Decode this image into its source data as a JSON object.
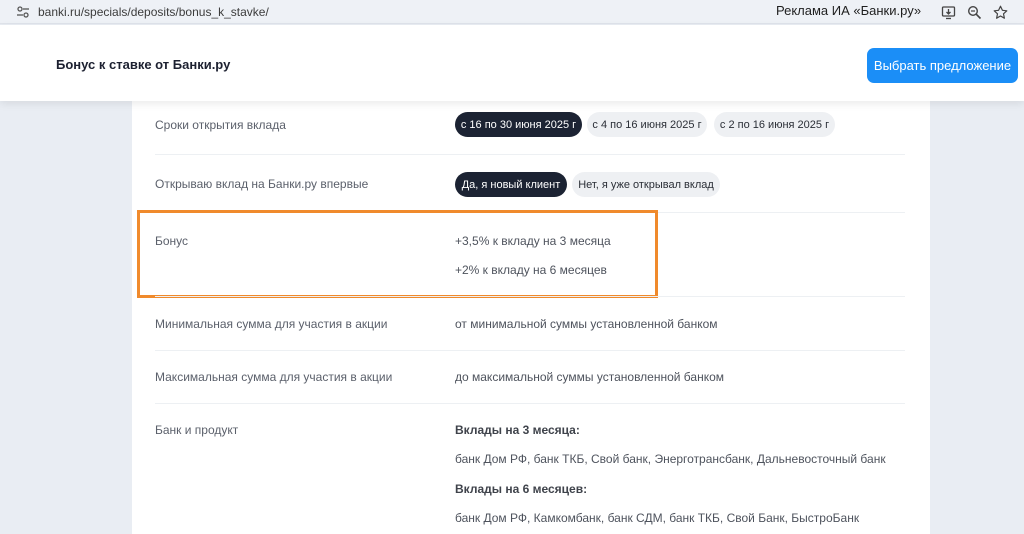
{
  "browser": {
    "url": "banki.ru/specials/deposits/bonus_k_stavke/",
    "ad_label": "Реклама ИА «Банки.ру»",
    "icons": [
      "site-settings-icon",
      "install-app-icon",
      "zoom-icon",
      "bookmark-star-icon"
    ]
  },
  "header": {
    "title": "Бонус к ставке от Банки.ру",
    "cta_label": "Выбрать предложение"
  },
  "rows": {
    "period": {
      "label": "Сроки открытия вклада",
      "options": [
        "с 16 по 30 июня 2025 г",
        "с 4 по 16 июня 2025 г",
        "с 2 по 16 июня 2025 г"
      ],
      "selected": "с 16 по 30 июня 2025 г"
    },
    "first_time": {
      "label": "Открываю вклад на Банки.ру впервые",
      "options": [
        "Да, я новый клиент",
        "Нет, я уже открывал вклад"
      ],
      "selected": "Да, я новый клиент"
    },
    "bonus": {
      "label": "Бонус",
      "values": [
        "+3,5% к вкладу на 3 месяца",
        "+2% к вкладу на 6 месяцев"
      ]
    },
    "min_sum": {
      "label": "Минимальная сумма для участия в акции",
      "value": "от минимальной суммы установленной банком"
    },
    "max_sum": {
      "label": "Максимальная сумма для участия в акции",
      "value": "до максимальной суммы установленной банком"
    },
    "bank_product": {
      "label": "Банк и продукт",
      "groups": [
        {
          "heading": "Вклады на 3 месяца:",
          "banks": "банк Дом РФ, банк ТКБ, Свой банк, Энерготрансбанк, Дальневосточный банк"
        },
        {
          "heading": "Вклады на 6 месяцев:",
          "banks": "банк Дом РФ, Камкомбанк, банк СДМ, банк ТКБ, Свой Банк, БыстроБанк"
        }
      ]
    }
  },
  "colors": {
    "accent": "#1b8ef7",
    "chip_active": "#1c2333",
    "chip_inactive": "#eef0f3",
    "highlight": "#f08a2c"
  }
}
